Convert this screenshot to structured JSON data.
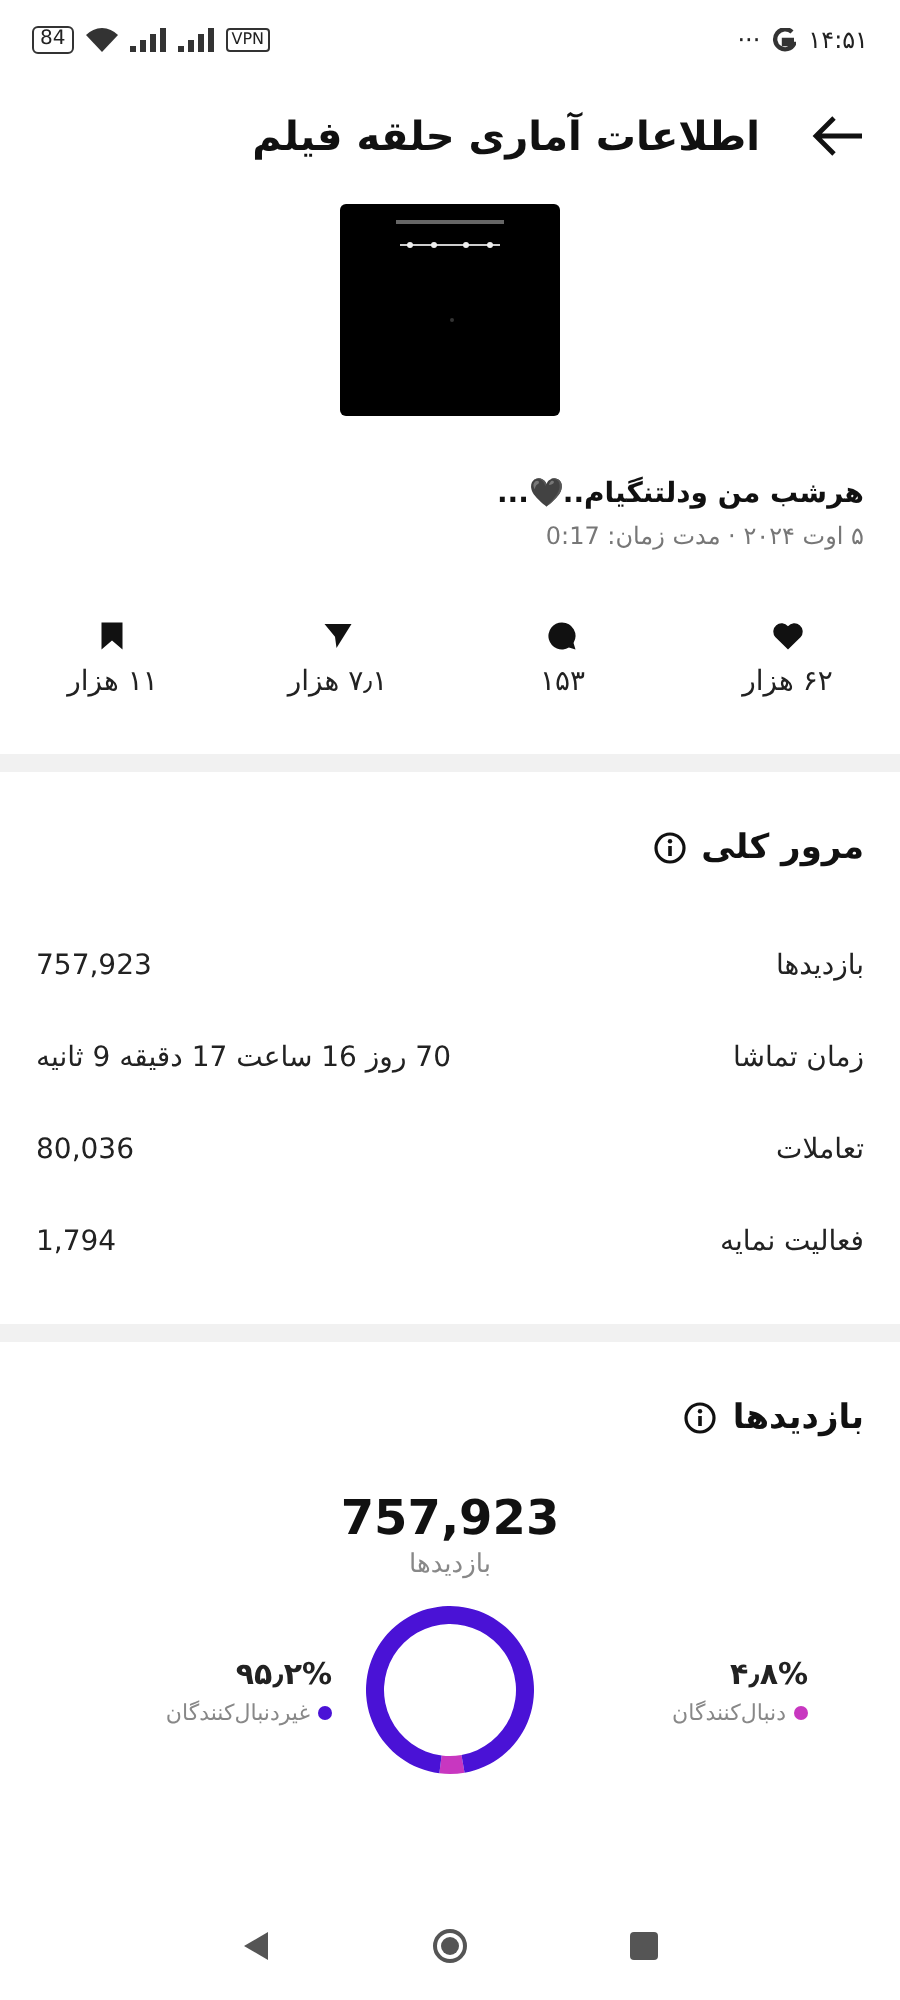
{
  "status_bar": {
    "battery": "84",
    "vpn": "VPN",
    "dots": "···",
    "time": "۱۴:۵۱"
  },
  "header": {
    "title": "اطلاعات آماری حلقه فیلم"
  },
  "post": {
    "caption": "هرشب من ودلتنگیام..🖤...",
    "meta": "۵ اوت ۲۰۲۴ · مدت زمان: 0:17"
  },
  "stats": [
    {
      "kind": "likes",
      "value": "۶۲ هزار"
    },
    {
      "kind": "comments",
      "value": "۱۵۳"
    },
    {
      "kind": "shares",
      "value": "۷٫۱ هزار"
    },
    {
      "kind": "saves",
      "value": "۱۱ هزار"
    }
  ],
  "overview": {
    "title": "مرور کلی",
    "rows": [
      {
        "label": "بازدیدها",
        "value": "757,923"
      },
      {
        "label": "زمان تماشا",
        "value": "70 روز 16 ساعت 17 دقیقه 9 ثانیه"
      },
      {
        "label": "تعاملات",
        "value": "80,036"
      },
      {
        "label": "فعالیت نمایه",
        "value": "1,794"
      }
    ]
  },
  "views": {
    "title": "بازدیدها",
    "total": "757,923",
    "chart_data": {
      "type": "donut",
      "categories": [
        "دنبال‌کنندگان",
        "غیردنبال‌کنندگان"
      ],
      "series": [
        {
          "name": "بازدیدها",
          "values": [
            4.8,
            95.2
          ]
        }
      ]
    },
    "legend": [
      {
        "value": "۴٫۸%",
        "color": "#c837c0"
      },
      {
        "value": "۹۵٫۲%",
        "color": "#4a12d6"
      }
    ]
  }
}
